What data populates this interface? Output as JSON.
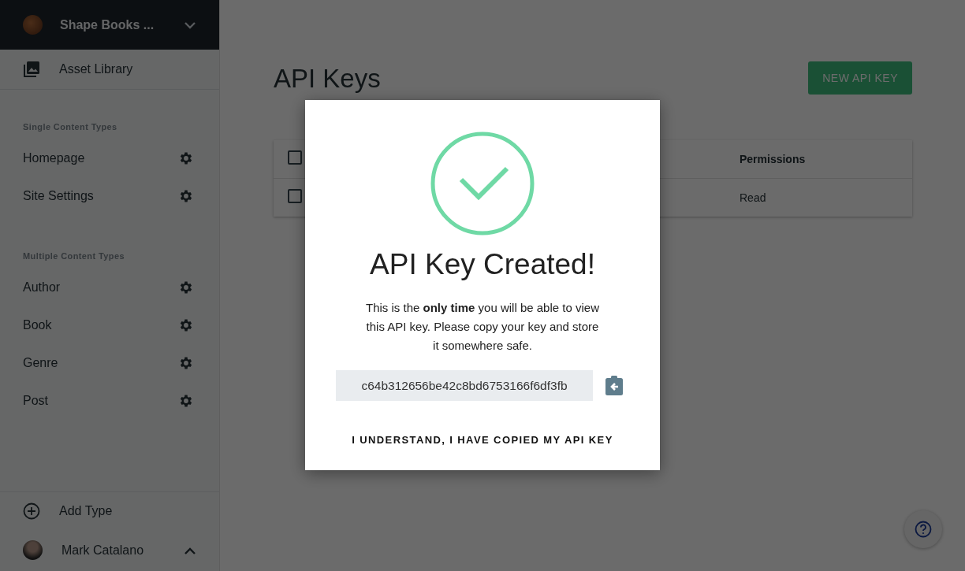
{
  "sidebar": {
    "org": {
      "name": "Shape Books ...",
      "expanded": false
    },
    "asset_library": "Asset Library",
    "sections": [
      {
        "title": "Single Content Types",
        "items": [
          "Homepage",
          "Site Settings"
        ]
      },
      {
        "title": "Multiple Content Types",
        "items": [
          "Author",
          "Book",
          "Genre",
          "Post"
        ]
      }
    ],
    "add_type": "Add Type",
    "user": {
      "name": "Mark Catalano",
      "expanded": true
    }
  },
  "main": {
    "title": "API Keys",
    "new_button": "NEW API KEY",
    "table": {
      "columns": [
        {
          "label": "Permissions"
        }
      ],
      "header_checked": false,
      "rows": [
        {
          "checked": false,
          "cells": [
            "Read"
          ]
        }
      ]
    }
  },
  "dialog": {
    "title": "API Key Created!",
    "message": "This is the **only time** you will be able to view this API key. Please copy your key and store it somewhere safe.",
    "key": "c64b312656be42c8bd6753166f6df3fb",
    "confirm": "I UNDERSTAND, I HAVE COPIED MY API KEY"
  }
}
